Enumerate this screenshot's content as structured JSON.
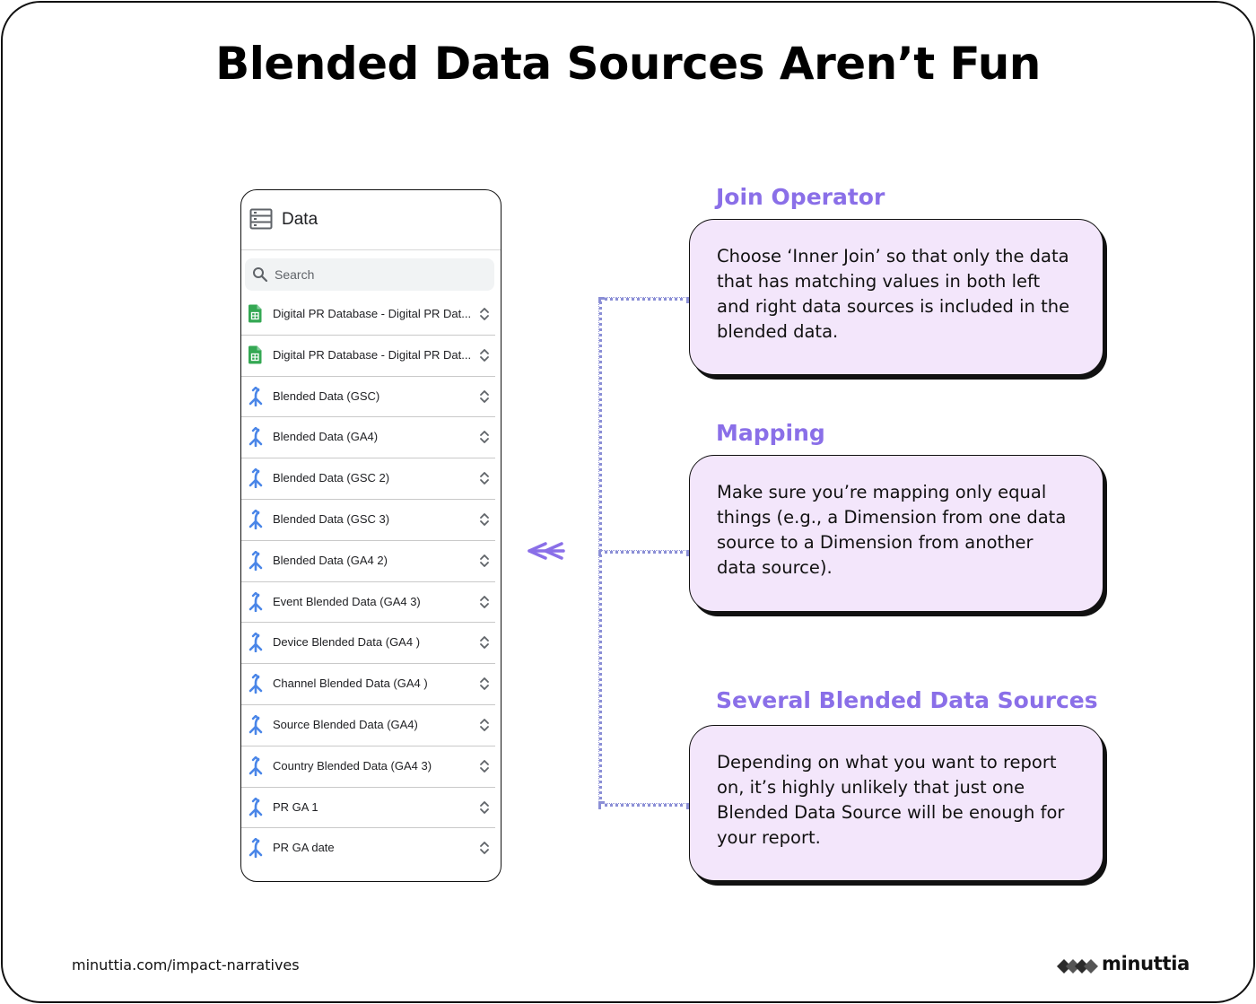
{
  "title": "Blended Data Sources Aren’t Fun",
  "panel": {
    "header_icon": "database-icon",
    "title": "Data",
    "search": {
      "placeholder": "Search"
    },
    "items": [
      {
        "label": "Digital PR Database - Digital PR Dat...",
        "icon": "google-sheets-icon"
      },
      {
        "label": "Digital PR Database - Digital PR Dat...",
        "icon": "google-sheets-icon"
      },
      {
        "label": "Blended Data (GSC)",
        "icon": "blend-icon"
      },
      {
        "label": "Blended Data (GA4)",
        "icon": "blend-icon"
      },
      {
        "label": "Blended Data (GSC 2)",
        "icon": "blend-icon"
      },
      {
        "label": "Blended Data (GSC 3)",
        "icon": "blend-icon"
      },
      {
        "label": "Blended Data (GA4 2)",
        "icon": "blend-icon"
      },
      {
        "label": "Event Blended Data (GA4 3)",
        "icon": "blend-icon"
      },
      {
        "label": "Device Blended Data (GA4 )",
        "icon": "blend-icon"
      },
      {
        "label": "Channel Blended Data (GA4 )",
        "icon": "blend-icon"
      },
      {
        "label": "Source Blended Data (GA4)",
        "icon": "blend-icon"
      },
      {
        "label": "Country Blended Data (GA4 3)",
        "icon": "blend-icon"
      },
      {
        "label": "PR GA 1",
        "icon": "blend-icon"
      },
      {
        "label": "PR GA date",
        "icon": "blend-icon"
      }
    ]
  },
  "callouts": [
    {
      "heading": "Join Operator",
      "text": "Choose ‘Inner Join’ so that only the data that has matching values in both left and right data sources is included in the blended data."
    },
    {
      "heading": "Mapping",
      "text": "Make sure you’re mapping only equal things (e.g., a Dimension from one data source to a Dimension from another data source)."
    },
    {
      "heading": "Several Blended Data Sources",
      "text": "Depending on what you want to report on, it’s highly unlikely that just one Blended Data Source will be enough for your report."
    }
  ],
  "footer": {
    "url": "minuttia.com/impact-narratives",
    "brand": "minuttia"
  },
  "colors": {
    "accent_heading": "#8a6fe8",
    "card_fill": "#f3e6fb",
    "sheets_green": "#34a853",
    "blend_blue": "#4a86e8",
    "connector": "#8b8fd6"
  }
}
